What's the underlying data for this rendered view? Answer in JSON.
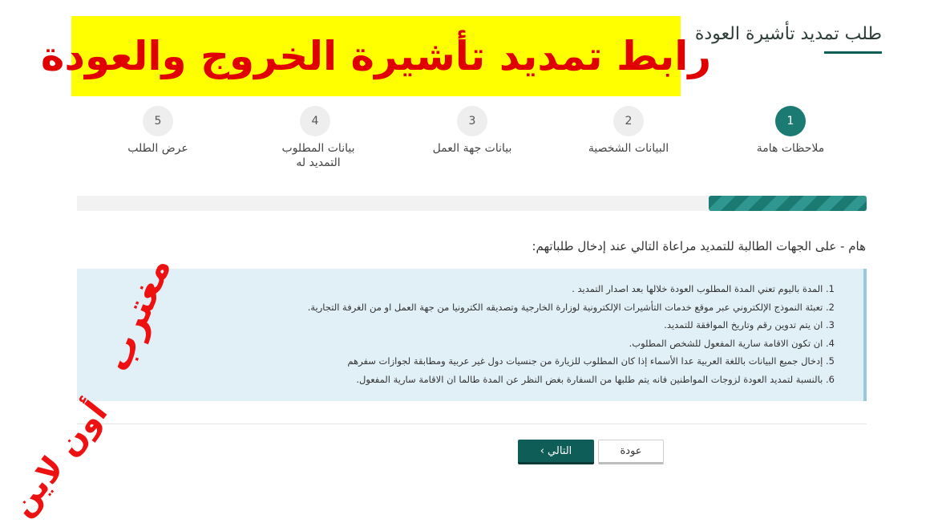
{
  "header": {
    "page_title": "طلب تمديد تأشيرة العودة",
    "banner_text": "رابط تمديد تأشيرة الخروج والعودة"
  },
  "steps": [
    {
      "number": "1",
      "label": "ملاحظات هامة",
      "active": true
    },
    {
      "number": "2",
      "label": "البيانات الشخصية",
      "active": false
    },
    {
      "number": "3",
      "label": "بيانات جهة العمل",
      "active": false
    },
    {
      "number": "4",
      "label": "بيانات المطلوب التمديد له",
      "active": false
    },
    {
      "number": "5",
      "label": "عرض الطلب",
      "active": false
    }
  ],
  "progress": {
    "fraction": 0.2
  },
  "notice": {
    "heading": "هام - على الجهات الطالبة للتمديد مراعاة التالي عند إدخال طلباتهم:",
    "items": [
      "1. المدة باليوم تعني المدة المطلوب العودة خلالها بعد اصدار التمديد .",
      "2. تعبئة النموذج الإلكتروني عبر موقع خدمات التأشيرات الإلكترونية لوزارة الخارجية وتصديقه الكترونيا من جهة العمل او من الغرفة التجارية.",
      "3. ان يتم تدوين رقم وتاريخ الموافقة للتمديد.",
      "4. ان تكون الاقامة سارية المفعول للشخص المطلوب.",
      "5. إدخال جميع البيانات باللغة العربية عدا الأسماء إذا كان المطلوب للزيارة من جنسيات دول غير عربية ومطابقة لجوازات سفرهم",
      "6. بالنسبة لتمديد العودة لزوجات المواطنين فانه يتم طلبها من السفارة بغض النظر عن المدة طالما ان الاقامة سارية المفعول."
    ]
  },
  "actions": {
    "next_label": "التالي ›",
    "back_label": "عودة"
  },
  "watermark": {
    "line1": "مغترب",
    "line2": "أون لاين"
  },
  "colors": {
    "primary": "#1b7a72",
    "banner_bg": "#ffff00",
    "banner_text": "#e00000",
    "notes_bg": "#e1eff6"
  }
}
